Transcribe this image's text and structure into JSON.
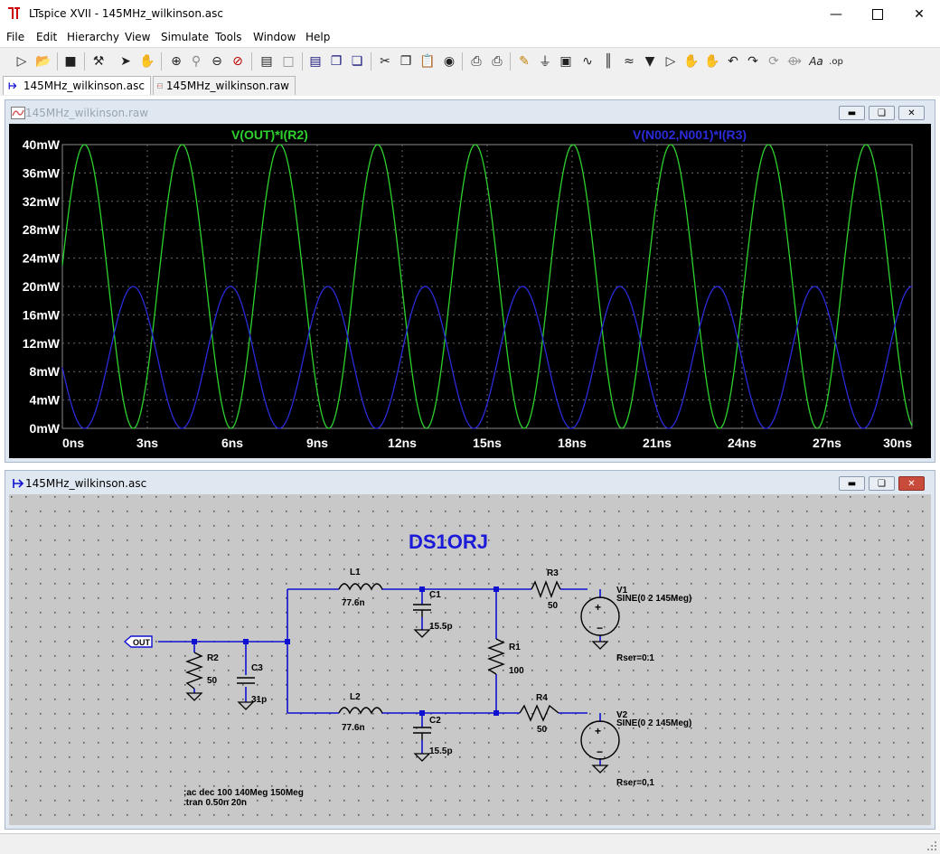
{
  "window": {
    "title": "LTspice XVII - 145MHz_wilkinson.asc"
  },
  "menu": [
    "File",
    "Edit",
    "Hierarchy",
    "View",
    "Simulate",
    "Tools",
    "Window",
    "Help"
  ],
  "toolbar": {
    "font_button_label": "Aa",
    "op_button_label": ".op"
  },
  "tabs": [
    {
      "label": "145MHz_wilkinson.asc",
      "icon": "schematic-icon",
      "active": true
    },
    {
      "label": "145MHz_wilkinson.raw",
      "icon": "waveform-icon",
      "active": false
    }
  ],
  "plot_window": {
    "title": "145MHz_wilkinson.raw",
    "trace1_label": "V(OUT)*I(R2)",
    "trace2_label": "V(N002,N001)*I(R3)",
    "colors": {
      "trace1": "#2ed12e",
      "trace2": "#2b2bd9",
      "background": "#000000",
      "axis_text": "#ffffff",
      "grid": "#6a6a6a"
    }
  },
  "chart_data": {
    "type": "line",
    "x_range": [
      0,
      30
    ],
    "x_unit": "ns",
    "y_range": [
      0,
      40
    ],
    "y_unit": "mW",
    "x_ticks": [
      "0ns",
      "3ns",
      "6ns",
      "9ns",
      "12ns",
      "15ns",
      "18ns",
      "21ns",
      "24ns",
      "27ns",
      "30ns"
    ],
    "y_ticks": [
      "0mW",
      "4mW",
      "8mW",
      "12mW",
      "16mW",
      "20mW",
      "24mW",
      "28mW",
      "32mW",
      "36mW",
      "40mW"
    ],
    "grid": true,
    "series": [
      {
        "name": "V(OUT)*I(R2)",
        "shape": "sin-squared",
        "peak_mW": 40,
        "peak_times_ns": [
          0.78,
          4.23,
          7.68,
          11.13,
          14.58,
          18.03,
          21.48,
          24.93,
          28.38
        ],
        "start_mW": 26
      },
      {
        "name": "V(N002,N001)*I(R3)",
        "shape": "sin-squared",
        "peak_mW": 20,
        "peak_times_ns": [
          2.5,
          5.95,
          9.4,
          12.85,
          16.3,
          19.75,
          23.2,
          26.65,
          30.0
        ],
        "start_mW": 7
      }
    ]
  },
  "schematic_window": {
    "title": "145MHz_wilkinson.asc",
    "heading": "DS1ORJ",
    "port_label": "OUT",
    "components": {
      "L1": {
        "name": "L1",
        "value": "77.6n"
      },
      "L2": {
        "name": "L2",
        "value": "77.6n"
      },
      "C1": {
        "name": "C1",
        "value": "15.5p"
      },
      "C2": {
        "name": "C2",
        "value": "15.5p"
      },
      "C3": {
        "name": "C3",
        "value": "31p"
      },
      "R1": {
        "name": "R1",
        "value": "100"
      },
      "R2": {
        "name": "R2",
        "value": "50"
      },
      "R3": {
        "name": "R3",
        "value": "50"
      },
      "R4": {
        "name": "R4",
        "value": "50"
      },
      "V1": {
        "name": "V1",
        "value": "SINE(0 2 145Meg)",
        "rser": "Rser=0.1"
      },
      "V2": {
        "name": "V2",
        "value": "SINE(0 2 145Meg)",
        "rser": "Rser=0.1"
      }
    },
    "directives": [
      ";ac dec 100 140Meg 150Meg",
      ".tran 0.50n 20n"
    ],
    "colors": {
      "wire": "#1010d0",
      "background": "#c8c8c8",
      "heading": "#1a1ad8"
    }
  }
}
